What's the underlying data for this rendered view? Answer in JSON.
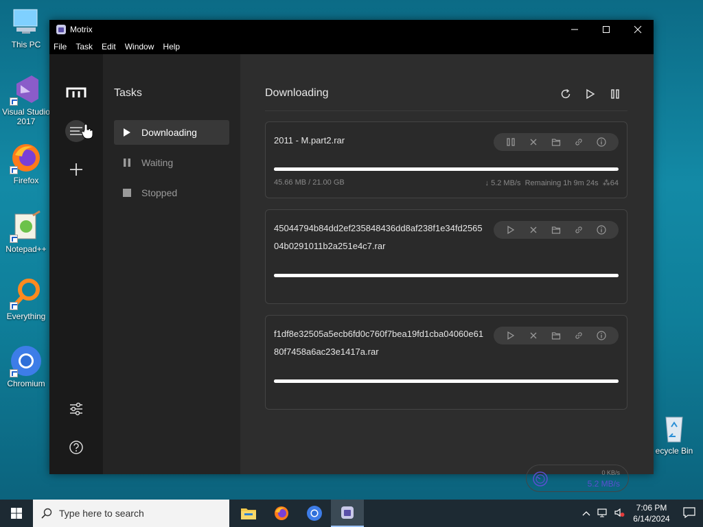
{
  "desktop": {
    "icons": [
      {
        "label": "This PC"
      },
      {
        "label": "Visual Studio 2017"
      },
      {
        "label": "Firefox"
      },
      {
        "label": "Notepad++"
      },
      {
        "label": "Everything"
      },
      {
        "label": "Chromium"
      },
      {
        "label": "ecycle Bin"
      }
    ]
  },
  "window": {
    "title": "Motrix",
    "menu": [
      "File",
      "Task",
      "Edit",
      "Window",
      "Help"
    ]
  },
  "sidebar": {
    "title": "Tasks",
    "items": [
      {
        "label": "Downloading",
        "icon": "play-icon"
      },
      {
        "label": "Waiting",
        "icon": "pause-icon"
      },
      {
        "label": "Stopped",
        "icon": "stop-icon"
      }
    ]
  },
  "main": {
    "heading": "Downloading",
    "tasks": [
      {
        "name": "2011 - M.part2.rar",
        "progress": 0.99,
        "size": "45.66 MB / 21.00 GB",
        "speed": "↓ 5.2 MB/s",
        "remaining": "Remaining 1h 9m 24s",
        "connections": "64"
      },
      {
        "name": "45044794b84dd2ef235848436dd8af238f1e34fd256504b0291011b2a251e4c7.rar",
        "progress": 1.0
      },
      {
        "name": "f1df8e32505a5ecb6fd0c760f7bea19fd1cba04060e6180f7458a6ac23e1417a.rar",
        "progress": 1.0
      }
    ],
    "speedometer": {
      "upload": "0 KB/s",
      "download": "5.2 MB/s"
    }
  },
  "taskbar": {
    "search_placeholder": "Type here to search",
    "time": "7:06 PM",
    "date": "6/14/2024"
  },
  "colors": {
    "accent": "#5b4fd1",
    "window_bg": "#2b2b2b"
  }
}
